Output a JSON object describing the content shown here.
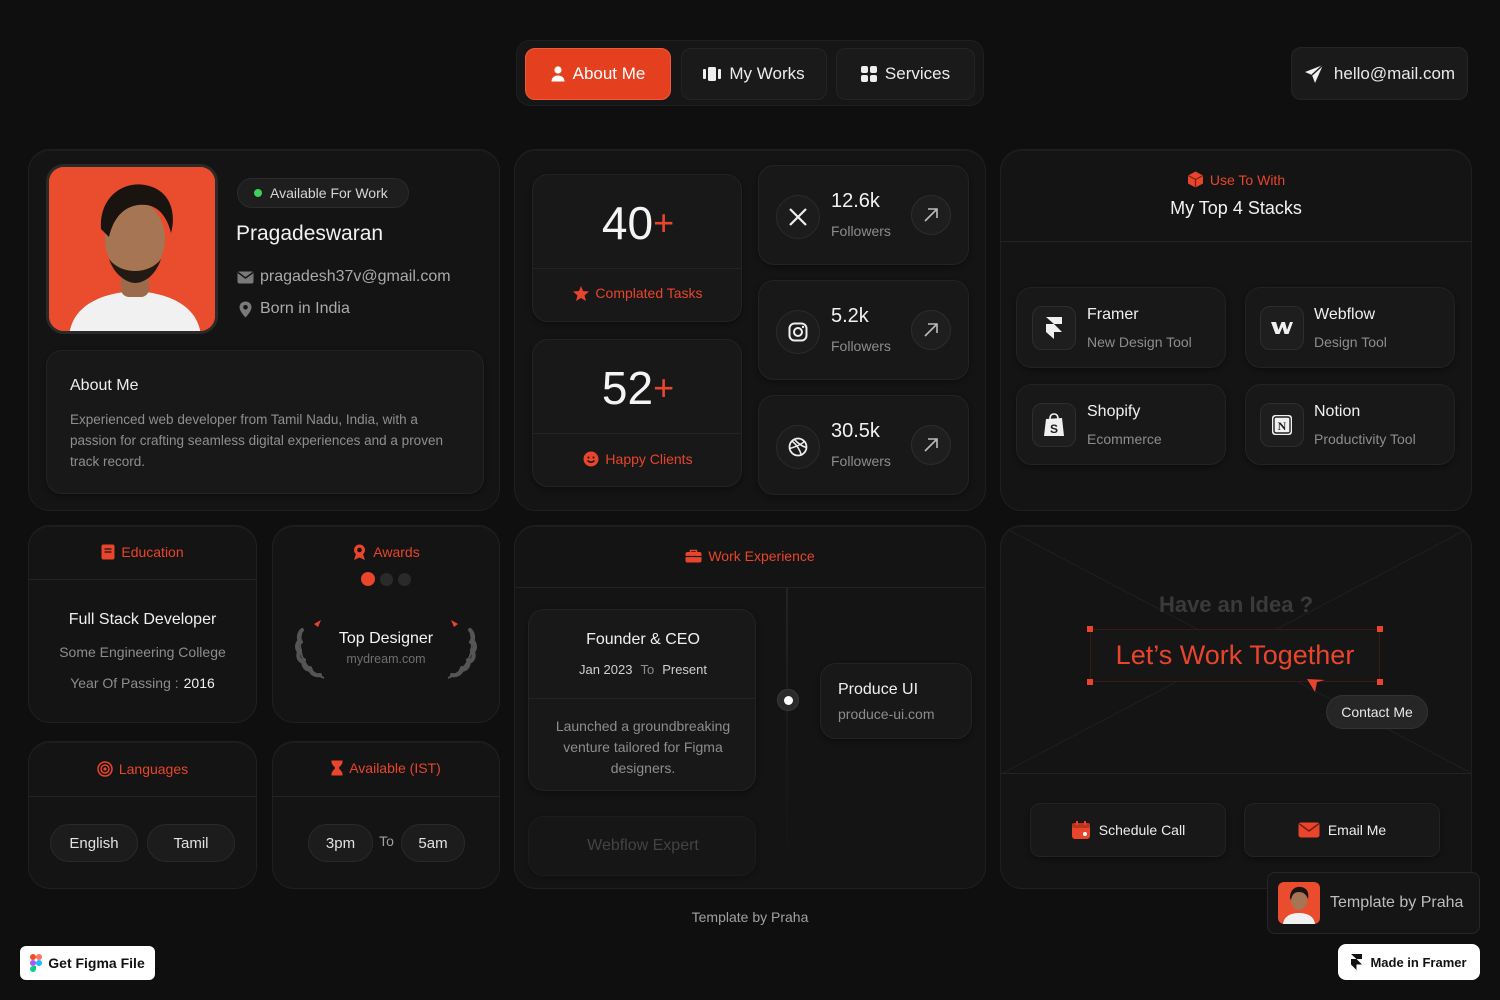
{
  "nav": {
    "about": "About Me",
    "works": "My Works",
    "services": "Services",
    "email": "hello@mail.com"
  },
  "profile": {
    "status": "Available For Work",
    "name": "Pragadeswaran",
    "email": "pragadesh37v@gmail.com",
    "location": "Born in India",
    "about_title": "About Me",
    "about_text": "Experienced web developer from Tamil Nadu, India, with a passion for crafting seamless digital experiences and a proven track record."
  },
  "stats": {
    "tasks_value": "40",
    "tasks_label": "Complated Tasks",
    "clients_value": "52",
    "clients_label": "Happy Clients",
    "plus": "+"
  },
  "social": [
    {
      "value": "12.6k",
      "label": "Followers",
      "icon": "x-icon"
    },
    {
      "value": "5.2k",
      "label": "Followers",
      "icon": "instagram-icon"
    },
    {
      "value": "30.5k",
      "label": "Followers",
      "icon": "dribbble-icon"
    }
  ],
  "stacks": {
    "eyebrow": "Use To With",
    "title": "My Top 4 Stacks",
    "items": [
      {
        "name": "Framer",
        "desc": "New Design Tool"
      },
      {
        "name": "Webflow",
        "desc": "Design Tool"
      },
      {
        "name": "Shopify",
        "desc": "Ecommerce"
      },
      {
        "name": "Notion",
        "desc": "Productivity Tool"
      }
    ]
  },
  "education": {
    "header": "Education",
    "role": "Full Stack Developer",
    "college": "Some Engineering College",
    "year_label": "Year Of Passing :",
    "year": "2016"
  },
  "awards": {
    "header": "Awards",
    "title": "Top Designer",
    "site": "mydream.com"
  },
  "languages": {
    "header": "Languages",
    "items": [
      "English",
      "Tamil"
    ]
  },
  "availability": {
    "header": "Available (IST)",
    "from": "3pm",
    "to_label": "To",
    "to": "5am"
  },
  "work": {
    "header": "Work Experience",
    "role": "Founder & CEO",
    "start": "Jan 2023",
    "to_label": "To",
    "end": "Present",
    "desc": "Launched a groundbreaking venture tailored for Figma designers.",
    "next_role": "Webflow Expert",
    "company": "Produce UI",
    "company_url": "produce-ui.com"
  },
  "cta": {
    "question": "Have an Idea ?",
    "headline": "Let’s Work Together",
    "tooltip": "Contact Me",
    "schedule": "Schedule Call",
    "email": "Email Me"
  },
  "footer": {
    "credit": "Template by Praha",
    "template_badge": "Template by Praha",
    "figma": "Get Figma File",
    "framer": "Made in Framer"
  },
  "colors": {
    "accent": "#e8452c",
    "background": "#0f0f0f",
    "card": "#141414",
    "status_green": "#3fcf5b"
  }
}
